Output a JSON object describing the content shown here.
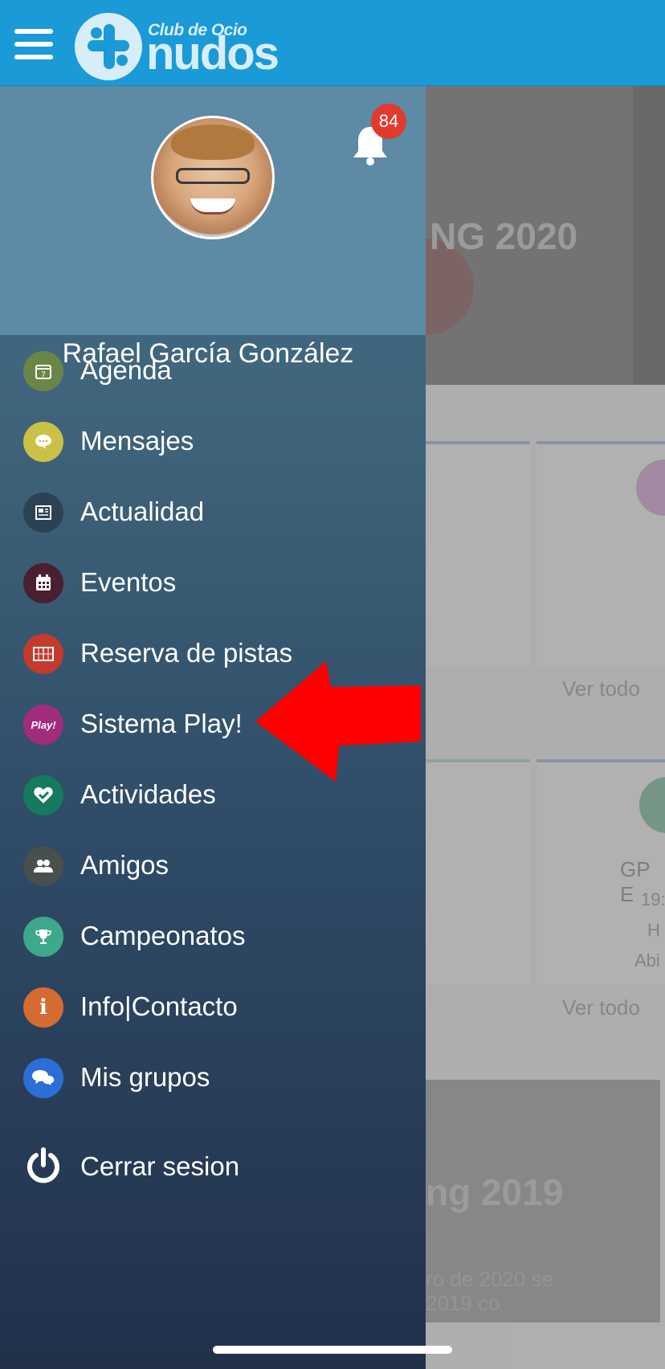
{
  "header": {
    "logo_small": "Club de Ocio",
    "logo_big": "nudos"
  },
  "profile": {
    "name": "Rafael García González",
    "notification_count": "84"
  },
  "menu": [
    {
      "label": "Agenda",
      "icon": "calendar-7-icon",
      "color": "#6b8547"
    },
    {
      "label": "Mensajes",
      "icon": "chat-bubble-icon",
      "color": "#c9c247"
    },
    {
      "label": "Actualidad",
      "icon": "newspaper-icon",
      "color": "#2d4155"
    },
    {
      "label": "Eventos",
      "icon": "calendar-grid-icon",
      "color": "#4a1f30"
    },
    {
      "label": "Reserva de pistas",
      "icon": "court-grid-icon",
      "color": "#c43a2c"
    },
    {
      "label": "Sistema Play!",
      "icon": "play-badge-icon",
      "icon_text": "Play!",
      "color": "#a12c7e"
    },
    {
      "label": "Actividades",
      "icon": "heart-check-icon",
      "color": "#157a5e"
    },
    {
      "label": "Amigos",
      "icon": "people-icon",
      "color": "#47504c"
    },
    {
      "label": "Campeonatos",
      "icon": "trophy-icon",
      "color": "#3ea88c"
    },
    {
      "label": "Info|Contacto",
      "icon": "info-icon",
      "icon_text": "i",
      "color": "#d46b33"
    },
    {
      "label": "Mis grupos",
      "icon": "group-chat-icon",
      "color": "#2a6fd6"
    }
  ],
  "logout": {
    "label": "Cerrar sesion",
    "icon": "power-icon"
  },
  "background": {
    "banner_title": "NG 2020",
    "ver_todo_1": "Ver todo",
    "ver_todo_2": "Ver todo",
    "card_text_1": "GP E",
    "card_text_2": "19:",
    "card_text_3": "H",
    "card_text_4": "Abi",
    "news_title": "ng 2019",
    "news_text_1": "ro de 2020 se",
    "news_text_2": "2019 co"
  },
  "annotation": {
    "arrow_color": "#ff0000"
  }
}
